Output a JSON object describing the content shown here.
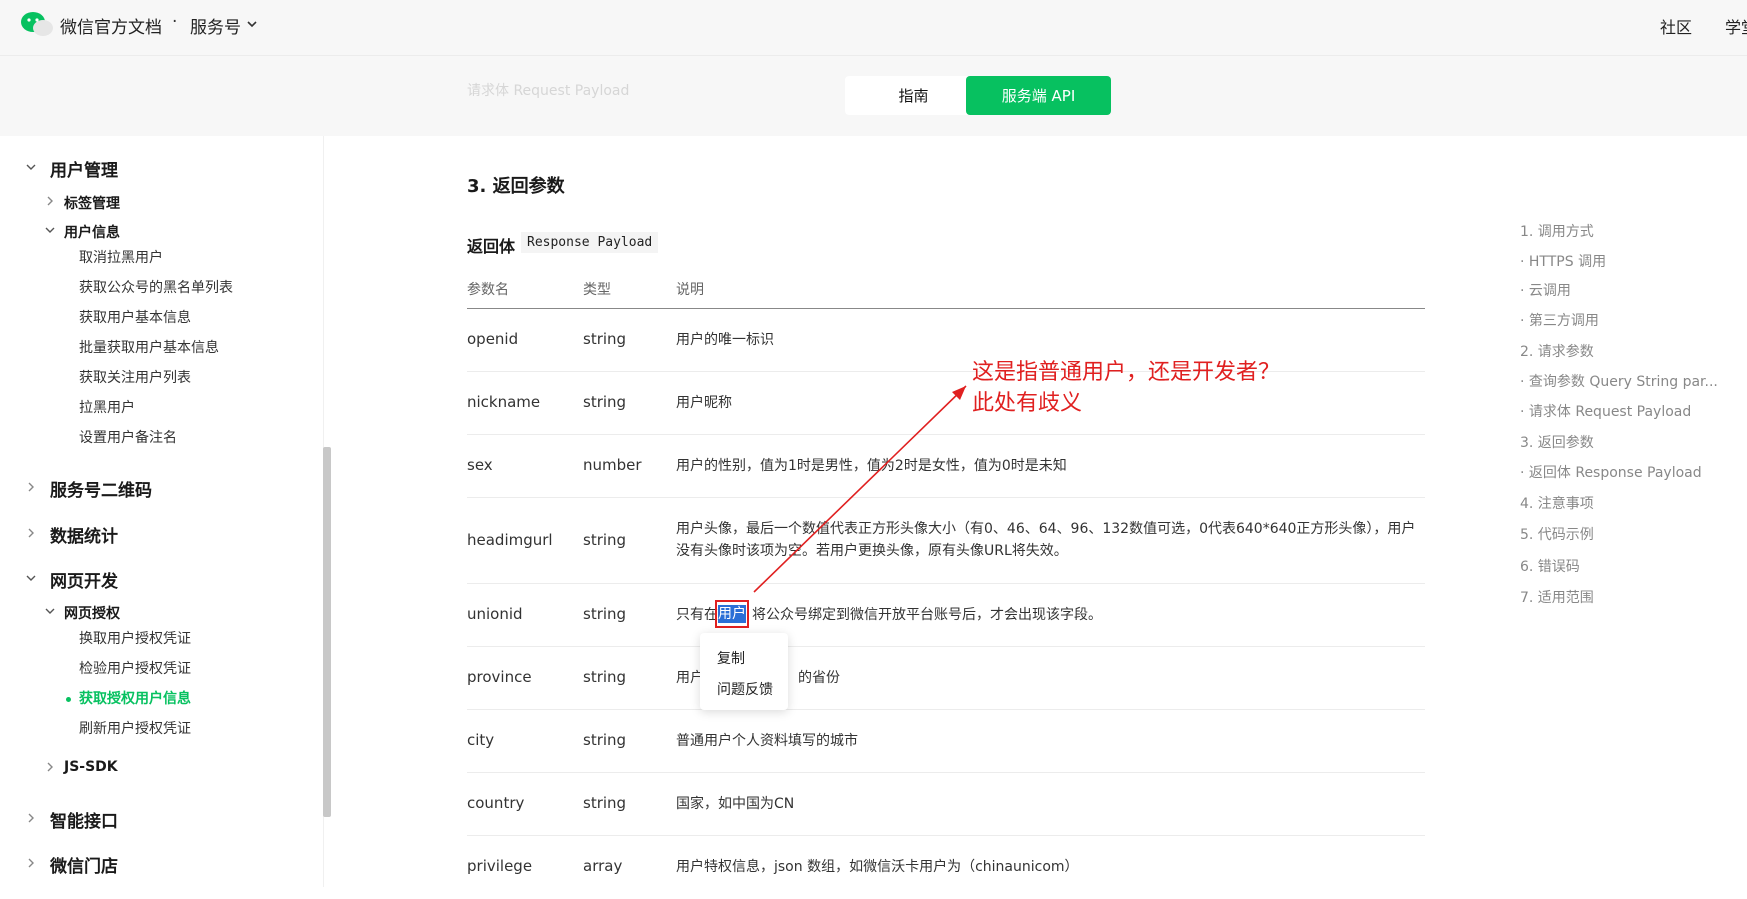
{
  "header": {
    "brand": "微信官方文档",
    "dot": "·",
    "service": "服务号",
    "nav_community": "社区",
    "nav_learn": "学堂"
  },
  "tabs": {
    "ghost_heading": "请求体 Request Payload",
    "guide": "指南",
    "server_api": "服务端 API"
  },
  "sidebar": {
    "user_mgmt": "用户管理",
    "tag_mgmt": "标签管理",
    "user_info": "用户信息",
    "items": [
      "取消拉黑用户",
      "获取公众号的黑名单列表",
      "获取用户基本信息",
      "批量获取用户基本信息",
      "获取关注用户列表",
      "拉黑用户",
      "设置用户备注名"
    ],
    "qrcode": "服务号二维码",
    "stats": "数据统计",
    "webdev": "网页开发",
    "web_auth": "网页授权",
    "auth_items": [
      "换取用户授权凭证",
      "检验用户授权凭证",
      "获取授权用户信息",
      "刷新用户授权凭证"
    ],
    "jssdk": "JS-SDK",
    "smart": "智能接口",
    "store": "微信门店"
  },
  "main": {
    "section_title": "3. 返回参数",
    "sub_title": "返回体",
    "sub_code": "Response Payload",
    "headers": [
      "参数名",
      "类型",
      "说明"
    ],
    "rows": [
      {
        "name": "openid",
        "type": "string",
        "desc": "用户的唯一标识"
      },
      {
        "name": "nickname",
        "type": "string",
        "desc": "用户昵称"
      },
      {
        "name": "sex",
        "type": "number",
        "desc": "用户的性别，值为1时是男性，值为2时是女性，值为0时是未知"
      },
      {
        "name": "headimgurl",
        "type": "string",
        "desc": "用户头像，最后一个数值代表正方形头像大小（有0、46、64、96、132数值可选，0代表640*640正方形头像），用户没有头像时该项为空。若用户更换头像，原有头像URL将失效。"
      },
      {
        "name": "unionid",
        "type": "string",
        "desc_pre": "只有在",
        "desc_sel": "用户",
        "desc_post": "将公众号绑定到微信开放平台账号后，才会出现该字段。"
      },
      {
        "name": "province",
        "type": "string",
        "desc_pre": "用户",
        "desc_post": "的省份"
      },
      {
        "name": "city",
        "type": "string",
        "desc": "普通用户个人资料填写的城市"
      },
      {
        "name": "country",
        "type": "string",
        "desc": "国家，如中国为CN"
      },
      {
        "name": "privilege",
        "type": "array",
        "desc": "用户特权信息，json 数组，如微信沃卡用户为（chinaunicom）"
      }
    ]
  },
  "context_menu": {
    "copy": "复制",
    "feedback": "问题反馈"
  },
  "annotation": {
    "line1": "这是指普通用户，还是开发者？",
    "line2": "此处有歧义",
    "color": "#e02020"
  },
  "toc": [
    "1. 调用方式",
    "· HTTPS 调用",
    "· 云调用",
    "· 第三方调用",
    "2. 请求参数",
    "· 查询参数 Query String par...",
    "· 请求体 Request Payload",
    "3. 返回参数",
    "· 返回体 Response Payload",
    "4. 注意事项",
    "5. 代码示例",
    "6. 错误码",
    "7. 适用范围"
  ],
  "colors": {
    "accent": "#07c160"
  }
}
